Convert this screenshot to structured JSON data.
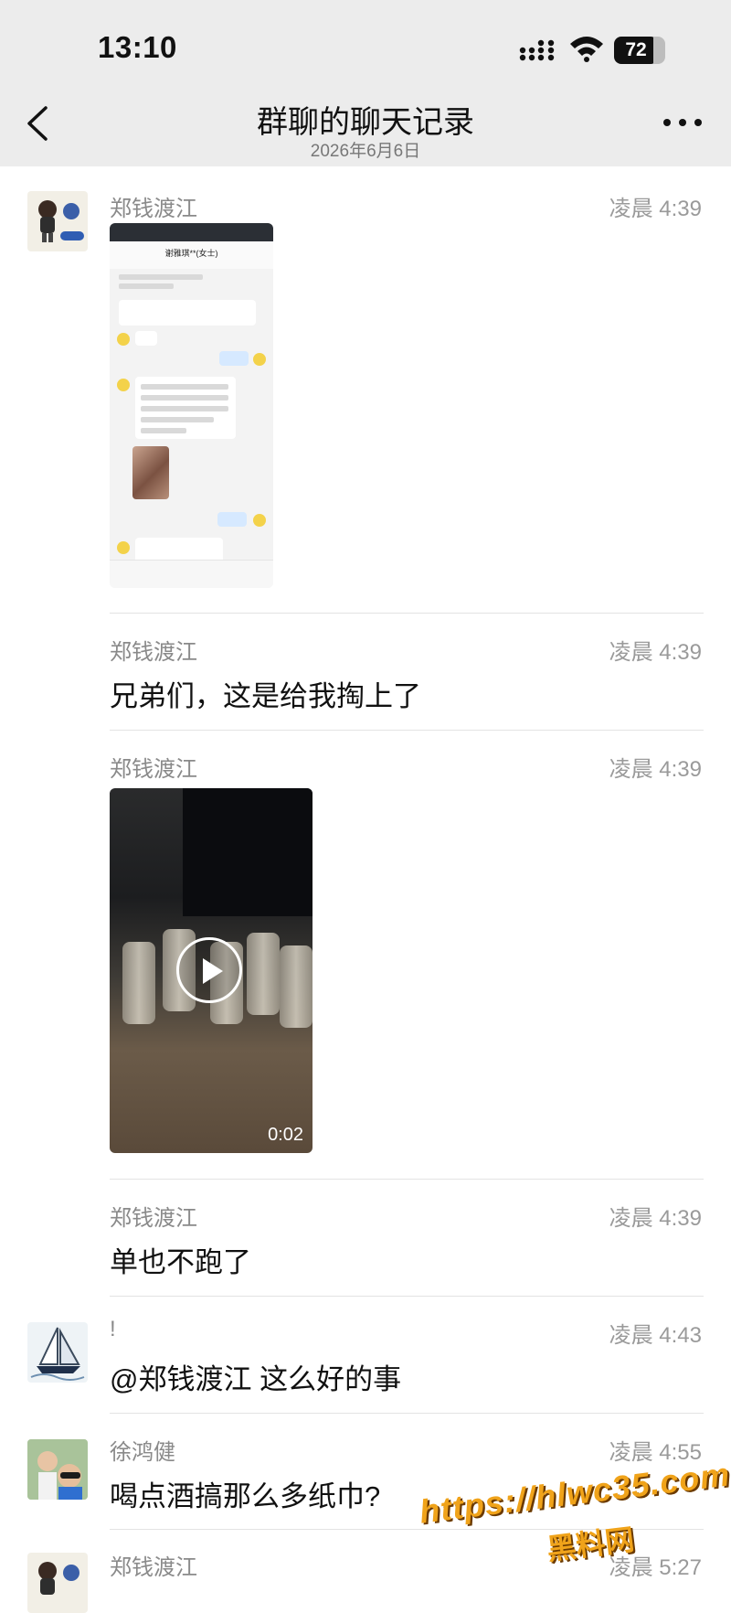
{
  "status": {
    "time": "13:10",
    "battery": "72",
    "battery_level": 72
  },
  "header": {
    "title": "群聊的聊天记录",
    "date": "2026年6月6日"
  },
  "messages": [
    {
      "sender": "郑钱渡江",
      "time": "凌晨 4:39",
      "type": "image",
      "image_caption": "谢雅琪**(女士)"
    },
    {
      "sender": "郑钱渡江",
      "time": "凌晨 4:39",
      "type": "text",
      "text": "兄弟们，这是给我掏上了"
    },
    {
      "sender": "郑钱渡江",
      "time": "凌晨 4:39",
      "type": "video",
      "video_duration": "0:02"
    },
    {
      "sender": "郑钱渡江",
      "time": "凌晨 4:39",
      "type": "text",
      "text": "单也不跑了"
    },
    {
      "sender": "!",
      "time": "凌晨 4:43",
      "type": "text",
      "text": "@郑钱渡江 这么好的事"
    },
    {
      "sender": "徐鸿健",
      "time": "凌晨 4:55",
      "type": "text",
      "text": "喝点酒搞那么多纸巾?"
    },
    {
      "sender": "郑钱渡江",
      "time": "凌晨 5:27",
      "type": "text"
    }
  ],
  "watermark": {
    "url": "https://hlwc35.com",
    "name": "黑料网"
  },
  "colors": {
    "nav_bg": "#ececec",
    "watermark": "#f0a31a",
    "sender": "#8a8a8a"
  }
}
